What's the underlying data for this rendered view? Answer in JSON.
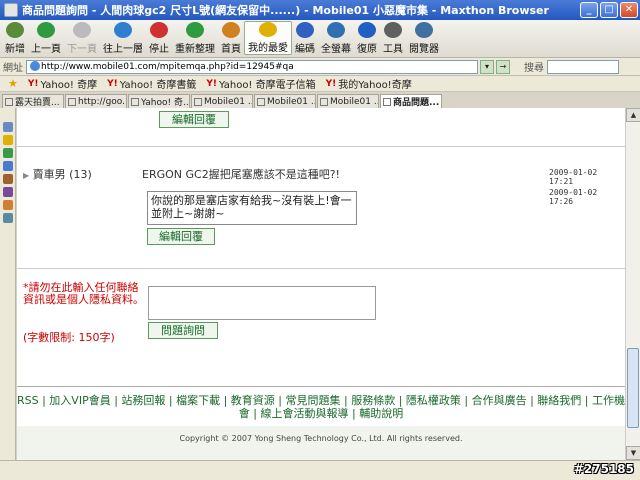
{
  "window": {
    "title": "商品問題詢問 - 人間肉球gc2 尺寸L號(網友保留中......) - Mobile01 小惡魔市集 - Maxthon Browser"
  },
  "toolbar": {
    "items": [
      {
        "label": "新增",
        "color": "#5a8a3a"
      },
      {
        "label": "上一頁",
        "color": "#2f9a3f"
      },
      {
        "label": "下一頁",
        "color": "#999999"
      },
      {
        "label": "往上一層",
        "color": "#2f7fd0"
      },
      {
        "label": "停止",
        "color": "#d03030"
      },
      {
        "label": "重新整理",
        "color": "#2f9a3f"
      },
      {
        "label": "首頁",
        "color": "#d08020"
      },
      {
        "label": "我的最愛",
        "color": "#e0b000"
      },
      {
        "label": "編碼",
        "color": "#3060c0"
      },
      {
        "label": "全螢幕",
        "color": "#3070b0"
      },
      {
        "label": "復原",
        "color": "#2060c0"
      },
      {
        "label": "工具",
        "color": "#606060"
      },
      {
        "label": "閱覽器",
        "color": "#4070a0"
      }
    ]
  },
  "address": {
    "label": "網址",
    "url": "http://www.mobile01.com/mpitemqa.php?id=12945#qa",
    "search_label": "搜尋"
  },
  "favorites": [
    {
      "label": "Yahoo! 奇摩"
    },
    {
      "label": "Yahoo! 奇摩書籤"
    },
    {
      "label": "Yahoo! 奇摩電子信箱"
    },
    {
      "label": "我的Yahoo!奇摩"
    }
  ],
  "tabs": [
    {
      "label": "露天拍賣..."
    },
    {
      "label": "http://goo..."
    },
    {
      "label": "Yahoo! 奇..."
    },
    {
      "label": "Mobile01 ..."
    },
    {
      "label": "Mobile01 ..."
    },
    {
      "label": "Mobile01 ..."
    },
    {
      "label": "商品問題..."
    }
  ],
  "content": {
    "edit_reply_1": "編輯回覆",
    "post": {
      "user": "賣車男 (13)",
      "question": "ERGON GC2握把尾塞應該不是這種吧?!",
      "question_date": "2009-01-02 17:21",
      "reply_date": "2009-01-02 17:26",
      "reply": "你說的那是塞店家有給我~沒有裝上!會一並附上~謝謝~",
      "edit_reply": "編輯回覆"
    },
    "notice": "*請勿在此輸入任何聯絡資訊或是個人隱私資料。",
    "char_limit": "(字數限制: 150字)",
    "ask_button": "問題詢問",
    "footer_links": "RSS | 加入VIP會員 | 站務回報 | 檔案下載 | 教育資源 | 常見問題集 | 服務條款 | 隱私權政策 | 合作與廣告 | 聯絡我們 | 工作機會 | 線上會活動與報導 | 輔助說明",
    "copyright": "Copyright © 2007 Yong Sheng Technology Co., Ltd. All rights reserved."
  },
  "watermark": "#275185"
}
